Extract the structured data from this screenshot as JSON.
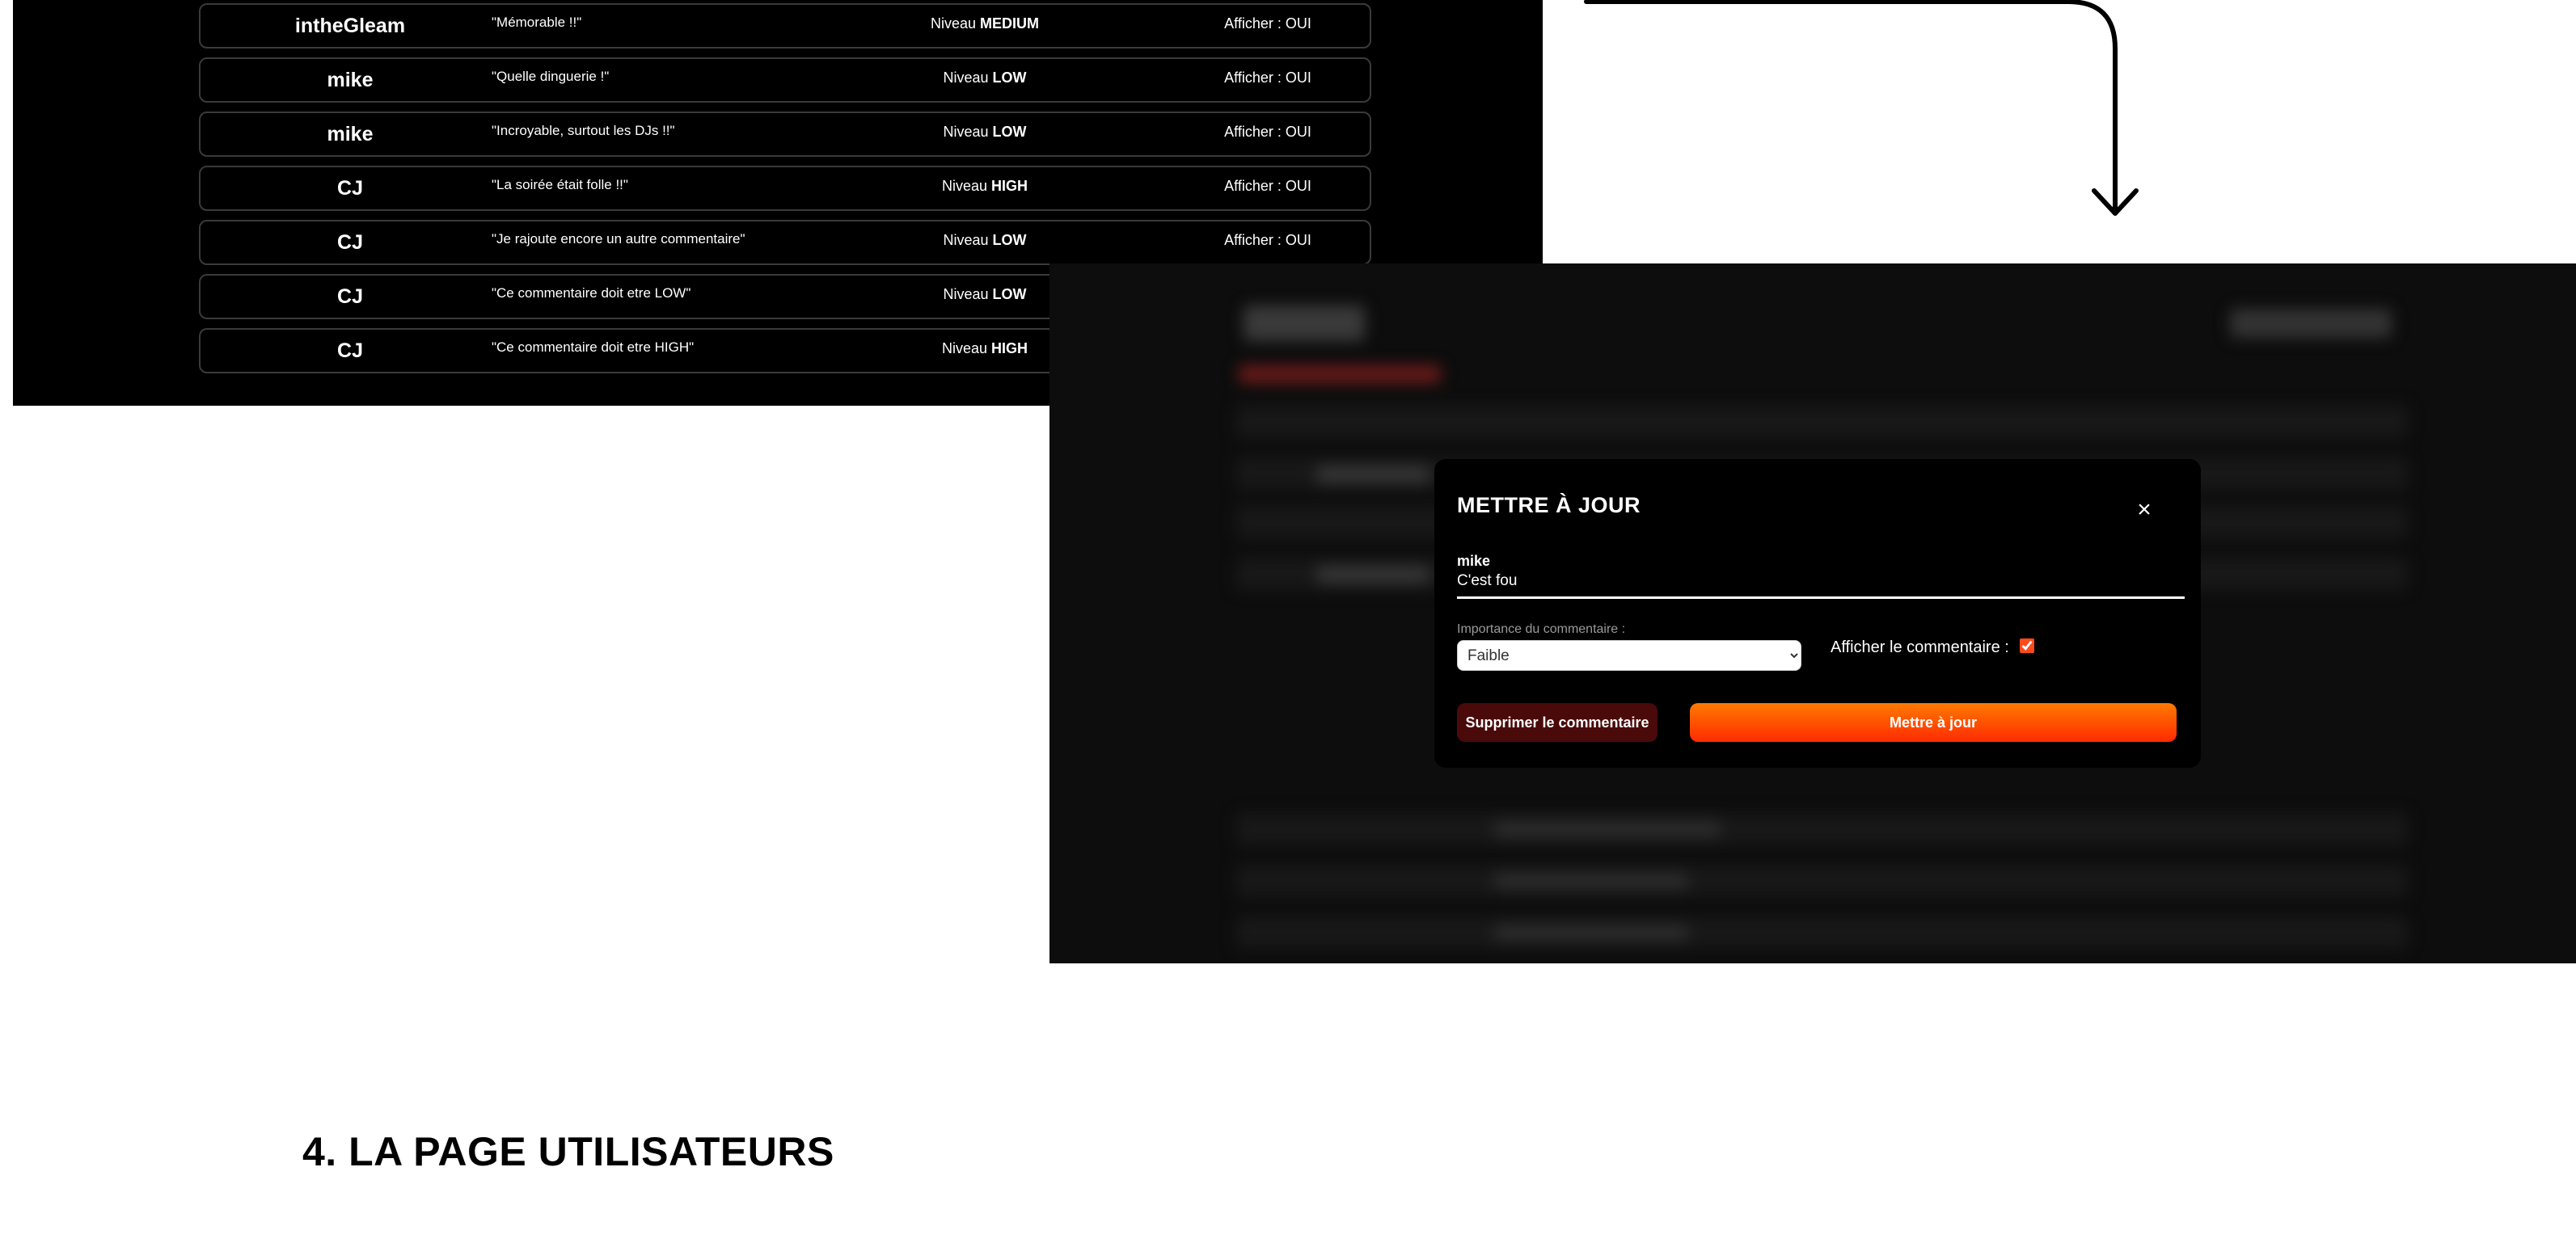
{
  "comments": [
    {
      "user": "intheGleam",
      "quote": "\"Mémorable !!\"",
      "level_prefix": "Niveau",
      "level": "MEDIUM",
      "show": "Afficher : OUI"
    },
    {
      "user": "mike",
      "quote": "\"Quelle dinguerie !\"",
      "level_prefix": "Niveau",
      "level": "LOW",
      "show": "Afficher : OUI"
    },
    {
      "user": "mike",
      "quote": "\"Incroyable, surtout les DJs !!\"",
      "level_prefix": "Niveau",
      "level": "LOW",
      "show": "Afficher : OUI"
    },
    {
      "user": "CJ",
      "quote": "\"La soirée était folle !!\"",
      "level_prefix": "Niveau",
      "level": "HIGH",
      "show": "Afficher : OUI"
    },
    {
      "user": "CJ",
      "quote": "\"Je rajoute encore un autre commentaire\"",
      "level_prefix": "Niveau",
      "level": "LOW",
      "show": "Afficher : OUI"
    },
    {
      "user": "CJ",
      "quote": "\"Ce commentaire doit etre LOW\"",
      "level_prefix": "Niveau",
      "level": "LOW",
      "show": ""
    },
    {
      "user": "CJ",
      "quote": "\"Ce commentaire doit etre HIGH\"",
      "level_prefix": "Niveau",
      "level": "HIGH",
      "show": ""
    }
  ],
  "modal": {
    "title": "METTRE À JOUR",
    "close": "×",
    "user": "mike",
    "comment": "C'est fou",
    "importance_label": "Importance du commentaire :",
    "importance_selected": "Faible",
    "show_label": "Afficher le commentaire :",
    "show_checked": true,
    "delete_button": "Supprimer le commentaire",
    "update_button": "Mettre à jour"
  },
  "section_heading": "4. LA PAGE UTILISATEURS",
  "colors": {
    "accent": "#ff4a1c",
    "delete_bg": "#4a0a0a",
    "panel_bg": "#000000"
  }
}
